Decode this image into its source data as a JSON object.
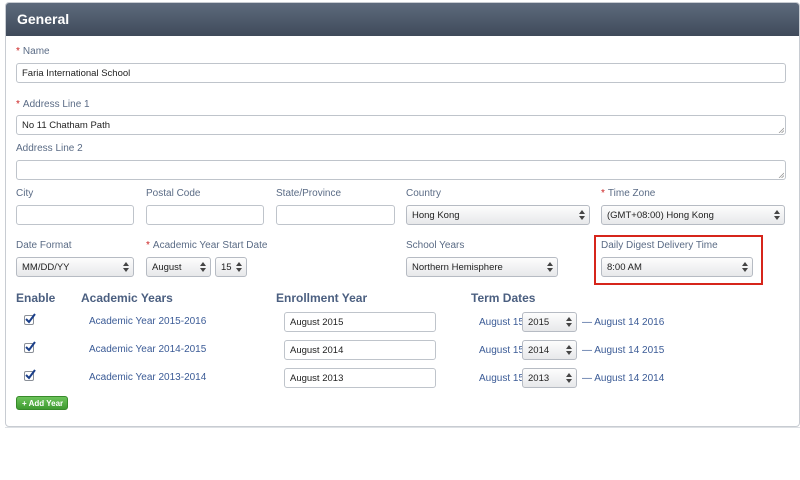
{
  "panel": {
    "title": "General"
  },
  "fields": {
    "name": {
      "label": "Name",
      "value": "Faria International School"
    },
    "address1": {
      "label": "Address Line 1",
      "value": "No 11 Chatham Path"
    },
    "address2": {
      "label": "Address Line 2",
      "value": ""
    },
    "city": {
      "label": "City",
      "value": ""
    },
    "postal_code": {
      "label": "Postal Code",
      "value": ""
    },
    "state": {
      "label": "State/Province",
      "value": ""
    },
    "country": {
      "label": "Country",
      "value": "Hong Kong"
    },
    "time_zone": {
      "label": "Time Zone",
      "value": "(GMT+08:00) Hong Kong"
    },
    "date_format": {
      "label": "Date Format",
      "value": "MM/DD/YY"
    },
    "academic_start": {
      "label": "Academic Year Start Date",
      "month": "August",
      "day": "15"
    },
    "school_years": {
      "label": "School Years",
      "value": "Northern Hemisphere"
    },
    "digest_time": {
      "label": "Daily Digest Delivery Time",
      "value": "8:00 AM"
    }
  },
  "years_table": {
    "headers": {
      "enable": "Enable",
      "academic_years": "Academic Years",
      "enrollment_year": "Enrollment Year",
      "term_dates": "Term Dates"
    },
    "rows": [
      {
        "enabled": true,
        "name": "Academic Year 2015-2016",
        "enrollment": "August 2015",
        "start": "August 15",
        "year": "2015",
        "end": "— August 14 2016"
      },
      {
        "enabled": true,
        "name": "Academic Year 2014-2015",
        "enrollment": "August 2014",
        "start": "August 15",
        "year": "2014",
        "end": "— August 14 2015"
      },
      {
        "enabled": true,
        "name": "Academic Year 2013-2014",
        "enrollment": "August 2013",
        "start": "August 15",
        "year": "2013",
        "end": "— August 14 2014"
      }
    ],
    "add_button": "+ Add Year"
  },
  "colors": {
    "header_bg": "#4a5668",
    "required": "#cc2222",
    "highlight": "#d6251b",
    "add_button": "#4fab3f"
  }
}
